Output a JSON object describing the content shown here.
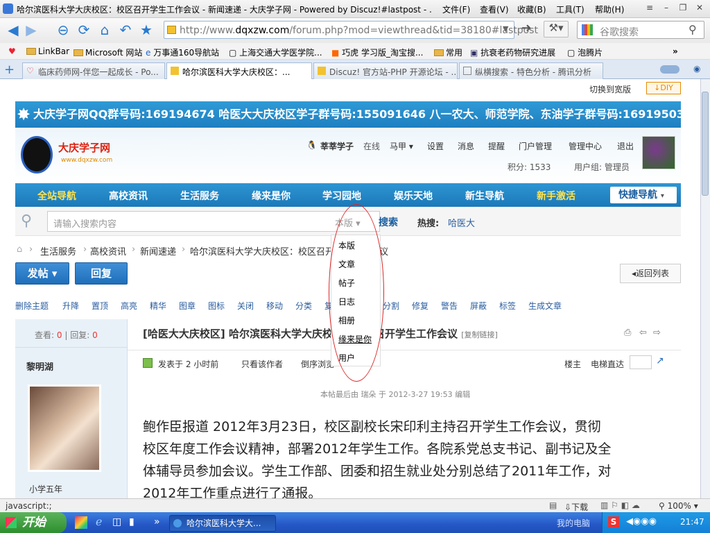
{
  "window": {
    "title": "哈尔滨医科大学大庆校区：校区召开学生工作会议 - 新闻速递 - 大庆学子网 - Powered by Discuz!#lastpost - ...",
    "menu": [
      "文件(F)",
      "查看(V)",
      "收藏(B)",
      "工具(T)",
      "帮助(H)"
    ]
  },
  "address": {
    "url_gray": "http://www.",
    "url_domain": "dqxzw.com",
    "url_rest": "/forum.php?mod=viewthread&tid=38180#lastpost",
    "search_placeholder": "谷歌搜索"
  },
  "bookmarks": [
    "LinkBar",
    "Microsoft 网站",
    "万事通160导航站",
    "上海交通大学医学院...",
    "巧虎 学习版_淘宝搜...",
    "常用",
    "抗衰老药物研究进展",
    "泡腾片"
  ],
  "tabs": [
    "临床药师网-伴您一起成长 - Po...",
    "哈尔滨医科大学大庆校区：...",
    "Discuz! 官方站-PHP 开源论坛 - ...",
    "纵横搜索 - 特色分析 - 腾讯分析"
  ],
  "topbar": {
    "wide": "切换到宽版",
    "diy": "DIY"
  },
  "banner": "大庆学子网QQ群号码:169194674 哈医大大庆校区学子群号码:155091646 八一农大、师范学院、东油学子群号码:169195037",
  "logo": {
    "name": "大庆学子网",
    "url": "www.dqxzw.com"
  },
  "user": {
    "name": "莘莘学子",
    "online": "在线",
    "items": [
      "马甲",
      "设置",
      "消息",
      "提醒",
      "门户管理",
      "管理中心",
      "退出"
    ],
    "points": "积分: 1533",
    "group": "用户组: 管理员"
  },
  "mainnav": [
    "全站导航",
    "高校资讯",
    "生活服务",
    "缘来是你",
    "学习园地",
    "娱乐天地",
    "新生导航",
    "新手激活"
  ],
  "quicknav": "快捷导航",
  "search": {
    "placeholder": "请输入搜索内容",
    "scope": "本版",
    "button": "搜索",
    "hot_label": "热搜:",
    "hot": "哈医大"
  },
  "dropdown": [
    "本版",
    "文章",
    "帖子",
    "日志",
    "相册",
    "缘来是你",
    "用户"
  ],
  "breadcrumb": [
    "生活服务",
    "高校资讯",
    "新闻速递",
    "哈尔滨医科大学大庆校区：校区召开学生工作会议"
  ],
  "buttons": {
    "post": "发帖",
    "reply": "回复",
    "back": "返回列表"
  },
  "modtools": [
    "删除主题",
    "升降",
    "置顶",
    "高亮",
    "精华",
    "图章",
    "图标",
    "关闭",
    "移动",
    "分类",
    "复制",
    "合并",
    "分割",
    "修复",
    "警告",
    "屏蔽",
    "标签",
    "生成文章"
  ],
  "thread": {
    "views_label": "查看:",
    "views": "0",
    "replies_label": "回复:",
    "replies": "0",
    "category": "[哈医大大庆校区]",
    "title": "哈尔滨医科大学大庆校区：校区召开学生工作会议",
    "copy": "[复制链接]",
    "author": "黎明湖",
    "posted": "发表于",
    "time": "2 小时前",
    "only_author": "只看该作者",
    "reverse": "倒序浏览",
    "floor": "楼主",
    "jump": "电梯直达",
    "edit_note": "本帖最后由 瑞朵 于 2012-3-27 19:53 编辑",
    "rank": "小学五年"
  },
  "content": [
    "鲍作臣报道  2012年3月23日，校区副校长宋印利主持召开学生工作会议，贯彻",
    "校区年度工作会议精神，部署2012年学生工作。各院系党总支书记、副书记及全",
    "体辅导员参加会议。学生工作部、团委和招生就业处分别总结了2011年工作，对",
    "2012年工作重点进行了通报。"
  ],
  "status": {
    "left": "javascript:;",
    "download": "下载",
    "zoom": "100%"
  },
  "taskbar": {
    "start": "开始",
    "task": "哈尔滨医科大学大...",
    "mypc": "我的电脑",
    "clock": "21:47"
  },
  "colors": {
    "accent": "#1e7fc0",
    "link": "#2a5d9f",
    "red": "#d22222"
  }
}
